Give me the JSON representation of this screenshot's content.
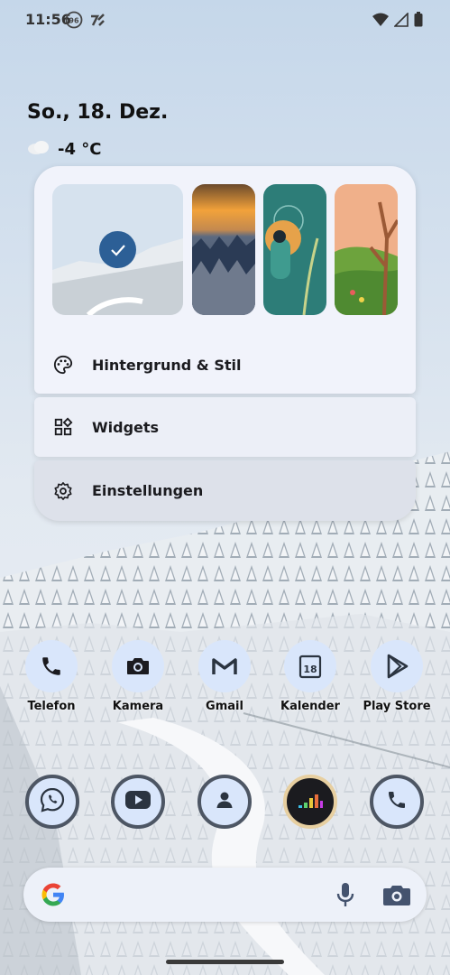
{
  "status_bar": {
    "time": "11:56",
    "notif_badge": "96",
    "icons": [
      "wifi-icon",
      "signal-icon",
      "battery-icon"
    ]
  },
  "home": {
    "date": "So., 18. Dez.",
    "weather": {
      "icon": "cloud-icon",
      "temp": "-4 °C"
    }
  },
  "long_press_menu": {
    "wallpapers": [
      {
        "name": "snowy-forest",
        "selected": true
      },
      {
        "name": "sunset-forest",
        "selected": false
      },
      {
        "name": "teal-illustration",
        "selected": false
      },
      {
        "name": "green-hills-tree",
        "selected": false
      }
    ],
    "items": [
      {
        "label": "Hintergrund & Stil",
        "icon": "palette-icon"
      },
      {
        "label": "Widgets",
        "icon": "widgets-icon"
      },
      {
        "label": "Einstellungen",
        "icon": "gear-icon"
      }
    ]
  },
  "apps": [
    {
      "label": "Telefon",
      "icon": "phone-icon"
    },
    {
      "label": "Kamera",
      "icon": "camera-icon"
    },
    {
      "label": "Gmail",
      "icon": "gmail-icon"
    },
    {
      "label": "Kalender",
      "icon": "calendar-icon",
      "day": "18"
    },
    {
      "label": "Play Store",
      "icon": "play-store-icon"
    }
  ],
  "dock": [
    {
      "icon": "whatsapp-icon"
    },
    {
      "icon": "youtube-icon"
    },
    {
      "icon": "contacts-icon"
    },
    {
      "icon": "deezer-icon"
    },
    {
      "icon": "phone-icon"
    }
  ],
  "search": {
    "logo": "google-g-icon",
    "icons": [
      "mic-icon",
      "lens-icon"
    ]
  },
  "colors": {
    "accent": "#2c5f96",
    "icon_bg": "#d9e6fb",
    "menu_bg": "#f1f3fb"
  }
}
